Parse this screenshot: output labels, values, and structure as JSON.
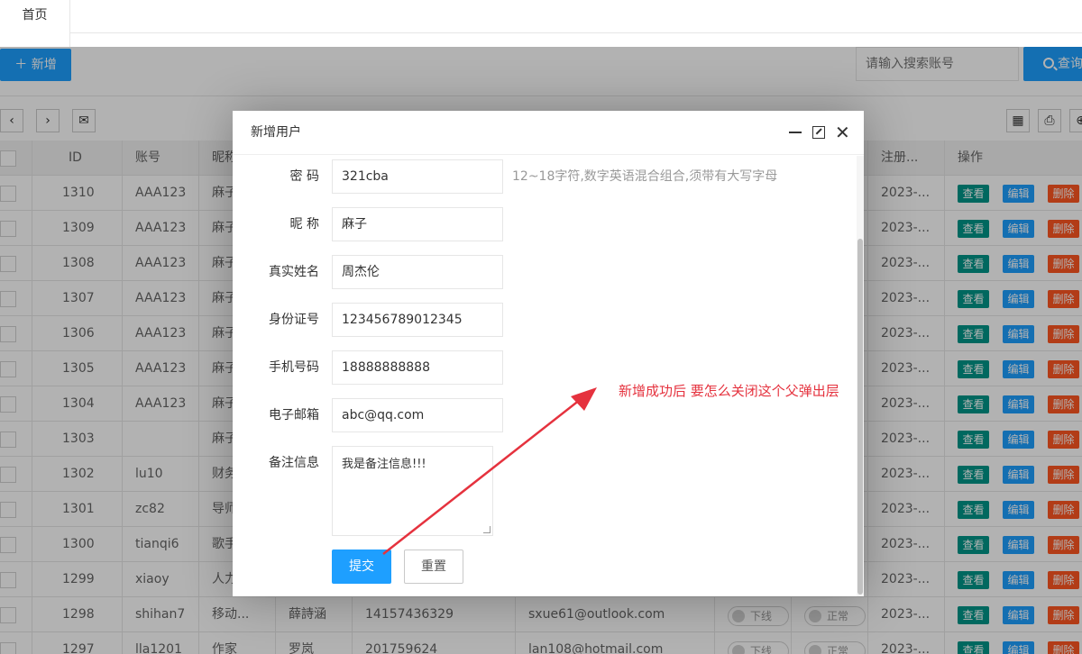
{
  "tabs": {
    "home": "首页"
  },
  "actions": {
    "add_label": "新增",
    "search_placeholder": "请输入搜索账号",
    "search_label": "查询"
  },
  "table": {
    "headers": {
      "id": "ID",
      "account": "账号",
      "nickname": "昵称",
      "register": "注册...",
      "ops": "操作"
    },
    "rows": [
      {
        "id": "1310",
        "account": "AAA123",
        "nick": "麻子",
        "reg": "2023-..."
      },
      {
        "id": "1309",
        "account": "AAA123",
        "nick": "麻子",
        "reg": "2023-..."
      },
      {
        "id": "1308",
        "account": "AAA123",
        "nick": "麻子",
        "reg": "2023-..."
      },
      {
        "id": "1307",
        "account": "AAA123",
        "nick": "麻子",
        "reg": "2023-..."
      },
      {
        "id": "1306",
        "account": "AAA123",
        "nick": "麻子",
        "reg": "2023-..."
      },
      {
        "id": "1305",
        "account": "AAA123",
        "nick": "麻子",
        "reg": "2023-..."
      },
      {
        "id": "1304",
        "account": "AAA123",
        "nick": "麻子",
        "reg": "2023-..."
      },
      {
        "id": "1303",
        "account": "",
        "nick": "麻子",
        "reg": "2023-..."
      },
      {
        "id": "1302",
        "account": "lu10",
        "nick": "财务",
        "reg": "2023-..."
      },
      {
        "id": "1301",
        "account": "zc82",
        "nick": "导师",
        "reg": "2023-..."
      },
      {
        "id": "1300",
        "account": "tianqi6",
        "nick": "歌手",
        "reg": "2023-..."
      },
      {
        "id": "1299",
        "account": "xiaoy",
        "nick": "人力",
        "reg": "2023-..."
      },
      {
        "id": "1298",
        "account": "shihan7",
        "nick": "移动...",
        "name": "薛詩涵",
        "phone": "14157436329",
        "email": "sxue61@outlook.com",
        "sw1": "下线",
        "sw2": "正常",
        "reg": "2023-..."
      },
      {
        "id": "1297",
        "account": "lla1201",
        "nick": "作家",
        "name": "罗岚",
        "phone": "201759624",
        "email": "lan108@hotmail.com",
        "sw1": "下线",
        "sw2": "正常",
        "reg": "2023-..."
      }
    ],
    "op_view": "查看",
    "op_edit": "编辑",
    "op_delete": "删除"
  },
  "dialog": {
    "title": "新增用户",
    "password_label": "密  码",
    "password_value": "321cba",
    "password_hint": "12~18字符,数字英语混合组合,须带有大写字母",
    "nickname_label": "昵  称",
    "nickname_value": "麻子",
    "realname_label": "真实姓名",
    "realname_value": "周杰伦",
    "idcard_label": "身份证号",
    "idcard_value": "123456789012345",
    "phone_label": "手机号码",
    "phone_value": "18888888888",
    "email_label": "电子邮箱",
    "email_value": "abc@qq.com",
    "remark_label": "备注信息",
    "remark_value": "我是备注信息!!!",
    "submit_label": "提交",
    "reset_label": "重置"
  },
  "annotation": "新增成功后 要怎么关闭这个父弹出层",
  "colors": {
    "primary": "#1E9FFF",
    "view": "#009688",
    "delete": "#FF5722",
    "annotation": "#e5323e"
  }
}
